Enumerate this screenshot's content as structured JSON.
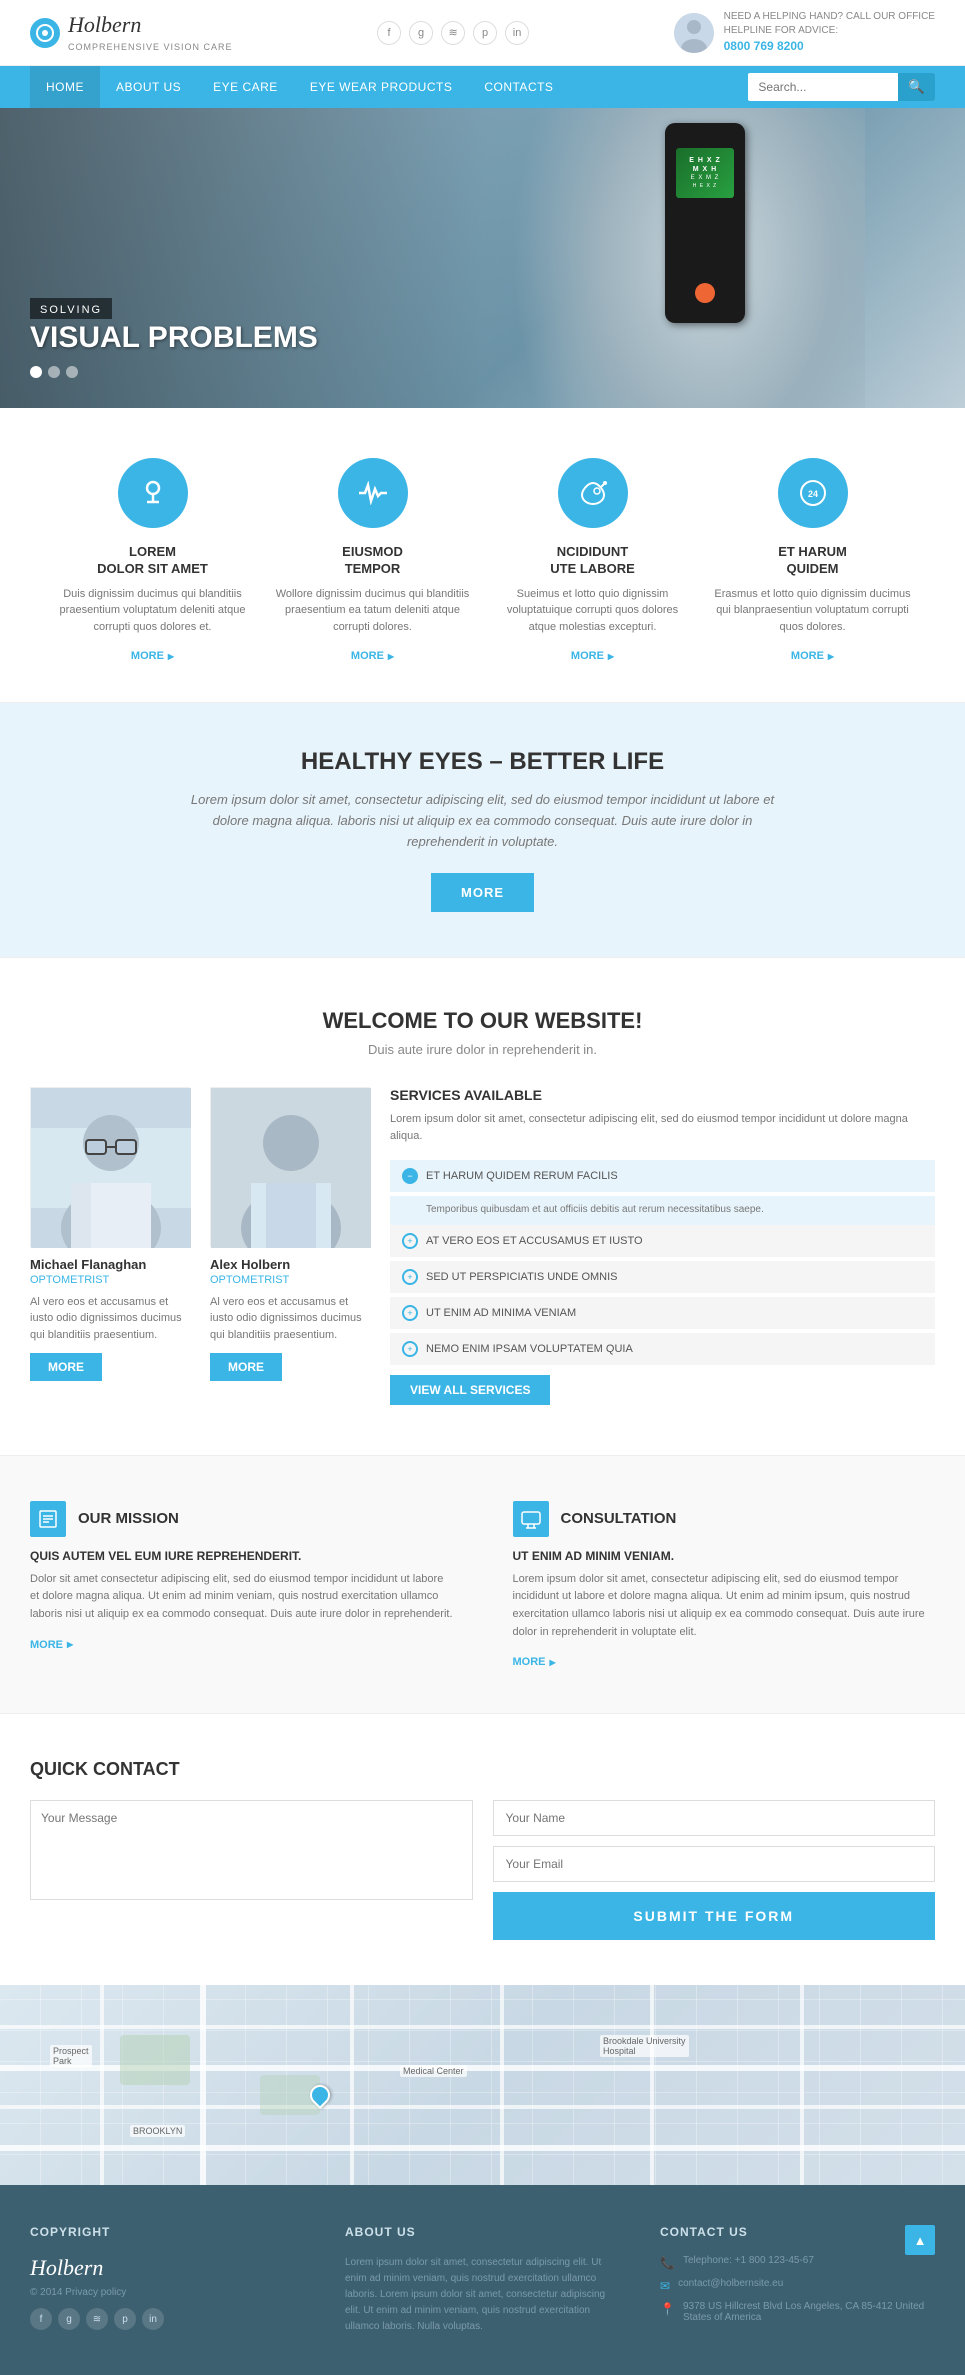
{
  "site": {
    "logo_name": "Holbern",
    "logo_sub": "COMPREHENSIVE VISION CARE",
    "tagline": "NEED A HELPING HAND? CALL OUR OFFICE",
    "search_label": "SEARCH",
    "helpline_label": "HELPLINE FOR ADVICE:",
    "helpline_number": "0800 769 8200"
  },
  "nav": {
    "items": [
      {
        "label": "HOME",
        "active": true
      },
      {
        "label": "ABOUT US",
        "active": false
      },
      {
        "label": "EYE CARE",
        "active": false
      },
      {
        "label": "EYE WEAR PRODUCTS",
        "active": false
      },
      {
        "label": "CONTACTS",
        "active": false
      }
    ],
    "search_placeholder": "Search..."
  },
  "hero": {
    "tag": "SOLVING",
    "title": "SOLVING",
    "subtitle": "VISUAL PROBLEMS",
    "device_text": "E H X Z\nM X H\nE X M Z\nH E X Z"
  },
  "features": {
    "items": [
      {
        "icon": "🔬",
        "title": "LOREM\nDOLOR SIT AMET",
        "desc": "Duis dignissim ducimus qui blanditiis praesentium voluptatum deleniti atque corrupti quos dolores et.",
        "more": "MORE"
      },
      {
        "icon": "💓",
        "title": "EIUSMOD\nTEMPOR",
        "desc": "Wollore dignissim ducimus qui blanditiis praesentium ea tatum deleniti atque corrupti dolores.",
        "more": "MORE"
      },
      {
        "icon": "💧",
        "title": "NCIDIDUNT\nUTE LABORE",
        "desc": "Sueimus et lotto quio dignissim voluptatuique corrupti quos dolores atque molestias excepturi.",
        "more": "MORE"
      },
      {
        "icon": "📞",
        "title": "ET HARUM\nQUIDEM",
        "desc": "Erasmus et lotto quio dignissim ducimus qui blanpraesentiun voluptatum corrupti quos dolores.",
        "more": "MORE"
      }
    ]
  },
  "banner": {
    "title": "HEALTHY EYES – BETTER LIFE",
    "text": "Lorem ipsum dolor sit amet, consectetur adipiscing elit, sed do eiusmod tempor incididunt ut labore et dolore magna aliqua. laboris nisi ut aliquip ex ea commodo consequat. Duis aute irure dolor in reprehenderit in voluptate.",
    "btn": "MORE"
  },
  "welcome": {
    "title": "WELCOME TO OUR WEBSITE!",
    "subtitle": "Duis aute irure dolor in reprehenderit in.",
    "doctors": [
      {
        "name": "Michael Flanaghan",
        "title": "OPTOMETRIST",
        "desc": "Al vero eos et accusamus et iusto odio dignissimos ducimus qui blanditiis praesentium.",
        "btn": "MORE"
      },
      {
        "name": "Alex Holbern",
        "title": "OPTOMETRIST",
        "desc": "Al vero eos et accusamus et iusto odio dignissimos ducimus qui blanditiis praesentium.",
        "btn": "MORE"
      }
    ],
    "services": {
      "title": "SERVICES AVAILABLE",
      "desc": "Lorem ipsum dolor sit amet, consectetur adipiscing elit, sed do eiusmod tempor incididunt ut dolore magna aliqua.",
      "items": [
        {
          "label": "ET HARUM QUIDEM RERUM FACILIS",
          "expanded": true,
          "desc": "Temporibus quibusdam et aut officiis debitis aut rerum necessitatibus saepe."
        },
        {
          "label": "AT VERO EOS ET ACCUSAMUS ET IUSTO",
          "expanded": false
        },
        {
          "label": "SED UT PERSPICIATIS UNDE OMNIS",
          "expanded": false
        },
        {
          "label": "UT ENIM AD MINIMA VENIAM",
          "expanded": false
        },
        {
          "label": "NEMO ENIM IPSAM VOLUPTATEM QUIA",
          "expanded": false
        }
      ],
      "view_all": "View All Services"
    }
  },
  "mission": {
    "left": {
      "icon": "📋",
      "title": "OUR MISSION",
      "subtitle": "QUIS AUTEM VEL EUM IURE REPREHENDERIT.",
      "text": "Dolor sit amet consectetur adipiscing elit, sed do eiusmod tempor incididunt ut labore et dolore magna aliqua. Ut enim ad minim veniam, quis nostrud exercitation ullamco laboris nisi ut aliquip ex ea commodo consequat. Duis aute irure dolor in reprehenderit.",
      "more": "MORE"
    },
    "right": {
      "icon": "💻",
      "title": "CONSULTATION",
      "subtitle": "UT ENIM AD MINIM VENIAM.",
      "text": "Lorem ipsum dolor sit amet, consectetur adipiscing elit, sed do eiusmod tempor incididunt ut labore et dolore magna aliqua. Ut enim ad minim ipsum, quis nostrud exercitation ullamco laboris nisi ut aliquip ex ea commodo consequat. Duis aute irure dolor in reprehenderit in voluptate elit.",
      "more": "MORE"
    }
  },
  "contact": {
    "title": "QUICK CONTACT",
    "message_placeholder": "Your Message",
    "name_placeholder": "Your Name",
    "email_placeholder": "Your Email",
    "submit": "SUBMIT THE FORM"
  },
  "footer": {
    "copyright_label": "COPYRIGHT",
    "about_label": "ABOUT US",
    "contact_label": "CONTACT US",
    "logo": "Holbern",
    "copy_text": "© 2014 Privacy policy",
    "about_text": "Lorem ipsum dolor sit amet, consectetur adipiscing elit. Ut enim ad minim veniam, quis nostrud exercitation ullamco laboris. Lorem ipsum dolor sit amet, consectetur adipiscing elit. Ut enim ad minim veniam, quis nostrud exercitation ullamco laboris. Nulla voluptas.",
    "social_icons": [
      "f",
      "g+",
      "rss",
      "p",
      "in"
    ],
    "contact_items": [
      {
        "icon": "📞",
        "text": "Telephone: +1 800 123-45-67"
      },
      {
        "icon": "✉",
        "text": "contact@holbernsite.eu"
      },
      {
        "icon": "📍",
        "text": "9378 US Hillcrest Blvd\nLos Angeles, CA 85-412\nUnited States of America"
      }
    ]
  }
}
